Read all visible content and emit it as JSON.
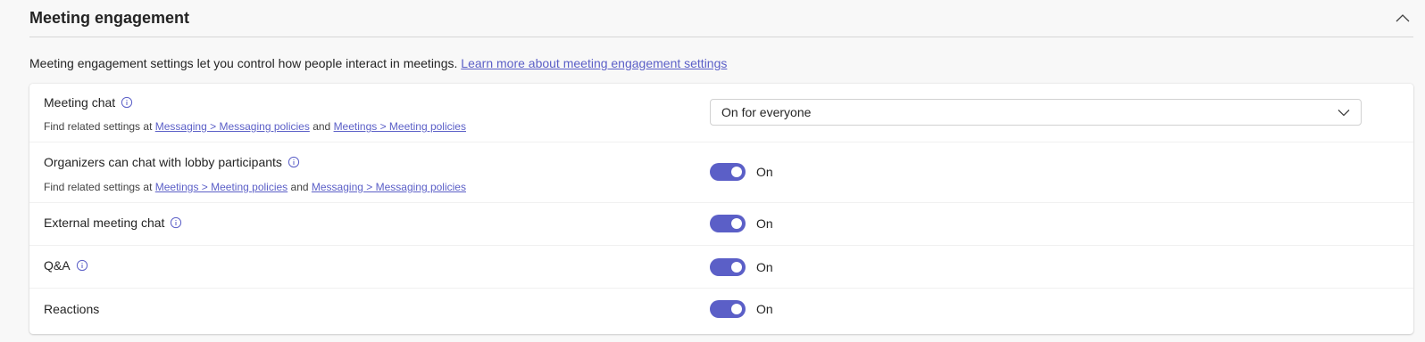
{
  "section": {
    "title": "Meeting engagement"
  },
  "description": {
    "text": "Meeting engagement settings let you control how people interact in meetings.",
    "link": "Learn more about meeting engagement settings"
  },
  "settings": {
    "meeting_chat": {
      "label": "Meeting chat",
      "related_prefix": "Find related settings at",
      "link1": "Messaging > Messaging policies",
      "and": "and",
      "link2": "Meetings > Meeting policies",
      "value": "On for everyone"
    },
    "lobby_chat": {
      "label": "Organizers can chat with lobby participants",
      "related_prefix": "Find related settings at",
      "link1": "Meetings > Meeting policies",
      "and": "and",
      "link2": "Messaging > Messaging policies",
      "state": "On"
    },
    "external_chat": {
      "label": "External meeting chat",
      "state": "On"
    },
    "qa": {
      "label": "Q&A",
      "state": "On"
    },
    "reactions": {
      "label": "Reactions",
      "state": "On"
    }
  },
  "colors": {
    "accent": "#5b5fc7",
    "background": "#f8f8f8",
    "card": "#ffffff"
  },
  "icons": {
    "collapse": "chevron-up-icon",
    "info": "info-icon",
    "dropdown": "chevron-down-icon"
  }
}
